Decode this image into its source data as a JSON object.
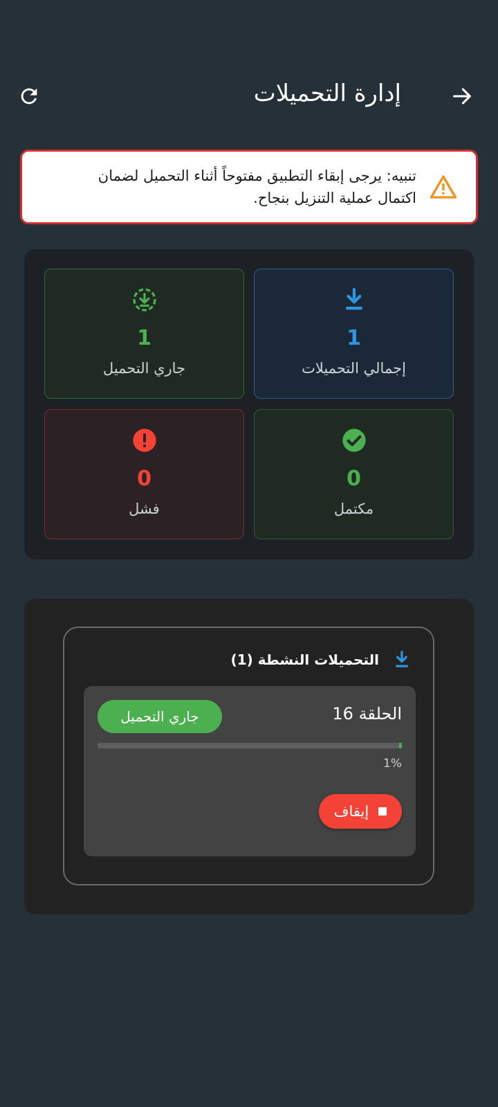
{
  "header": {
    "title": "إدارة التحميلات",
    "back_icon": "arrow-right-icon",
    "refresh_icon": "refresh-icon"
  },
  "alert": {
    "icon": "warning-icon",
    "line1": "تنبيه: يرجى إبقاء التطبيق مفتوحاً أثناء التحميل لضمان",
    "line2": "اكتمال عملية التنزيل بنجاح."
  },
  "stats": {
    "total": {
      "value": "1",
      "label": "إجمالي التحميلات",
      "icon": "download-icon",
      "color": "#2f95e0"
    },
    "active": {
      "value": "1",
      "label": "جاري التحميل",
      "icon": "downloading-icon",
      "color": "#4caf50"
    },
    "completed": {
      "value": "0",
      "label": "مكتمل",
      "icon": "check-circle-icon",
      "color": "#4caf50"
    },
    "failed": {
      "value": "0",
      "label": "فشل",
      "icon": "error-icon",
      "color": "#f44336"
    }
  },
  "active_downloads": {
    "title": "التحميلات النشطة (1)",
    "icon": "download-icon",
    "items": [
      {
        "name": "الحلقة 16",
        "status": "جاري التحميل",
        "progress": 0.01,
        "percent_label": "1%",
        "stop_label": "إيقاف"
      }
    ]
  },
  "colors": {
    "background": "#263038",
    "accent_blue": "#2f95e0",
    "accent_green": "#4caf50",
    "accent_red": "#f44336",
    "warning_orange": "#f0921e"
  }
}
